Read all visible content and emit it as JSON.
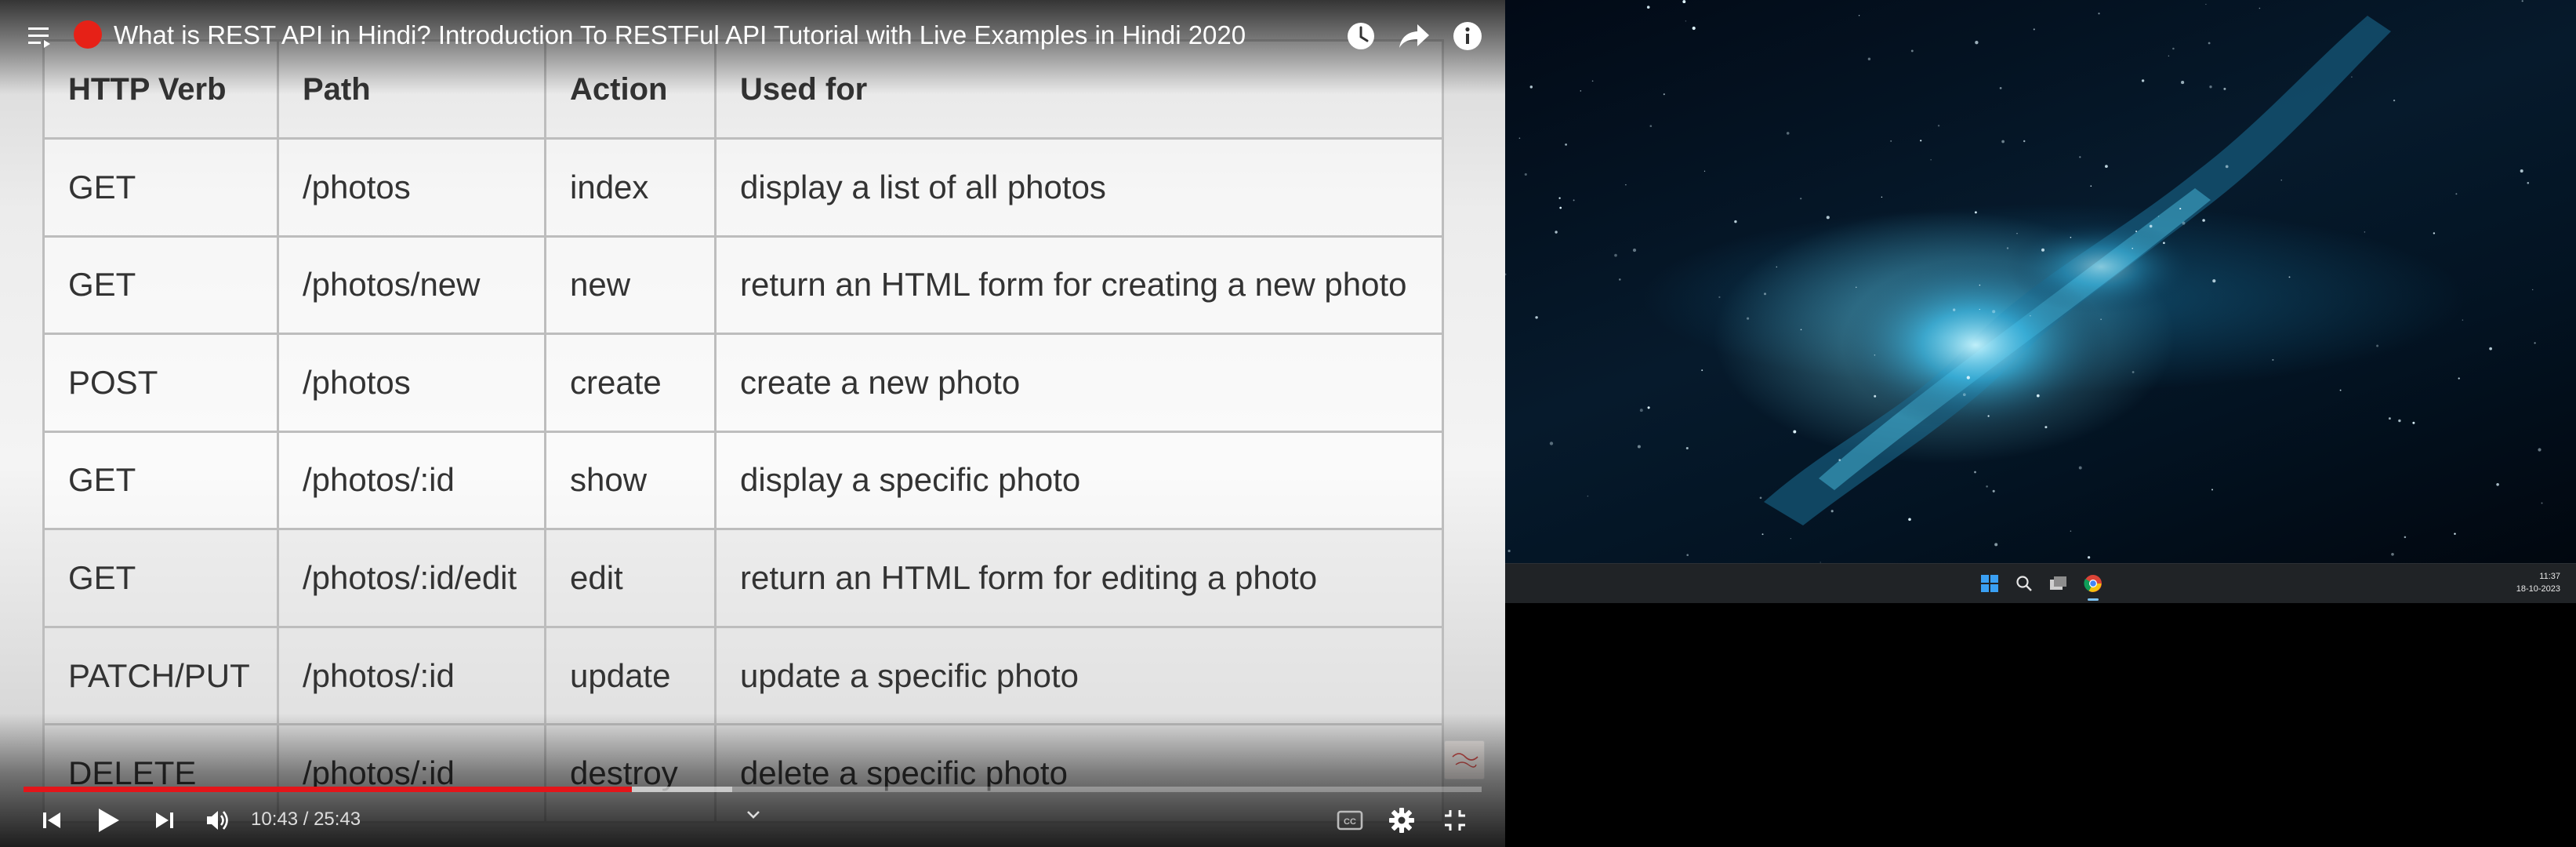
{
  "video": {
    "title": "What is REST API in Hindi? Introduction To RESTFul API Tutorial with Live Examples in Hindi 2020",
    "current_time": "10:43",
    "duration": "25:43",
    "time_display": "10:43 / 25:43",
    "progress_fraction": 0.417,
    "buffered_fraction": 0.486
  },
  "table": {
    "headers": [
      "HTTP Verb",
      "Path",
      "Action",
      "Used for"
    ],
    "rows": [
      [
        "GET",
        "/photos",
        "index",
        "display a list of all photos"
      ],
      [
        "GET",
        "/photos/new",
        "new",
        "return an HTML form for creating a new photo"
      ],
      [
        "POST",
        "/photos",
        "create",
        "create a new photo"
      ],
      [
        "GET",
        "/photos/:id",
        "show",
        "display a specific photo"
      ],
      [
        "GET",
        "/photos/:id/edit",
        "edit",
        "return an HTML form for editing a photo"
      ],
      [
        "PATCH/PUT",
        "/photos/:id",
        "update",
        "update a specific photo"
      ],
      [
        "DELETE",
        "/photos/:id",
        "destroy",
        "delete a specific photo"
      ]
    ]
  },
  "taskbar": {
    "time": "11:37",
    "date": "18-10-2023"
  },
  "icons": {
    "playlist": "playlist-icon",
    "watch_later": "clock-icon",
    "share": "share-icon",
    "info": "info-icon",
    "prev": "skip-previous-icon",
    "play": "play-icon",
    "next": "skip-next-icon",
    "volume": "volume-icon",
    "chevron": "chevron-down-icon",
    "captions": "captions-icon",
    "settings": "gear-icon",
    "exit_fullscreen": "exit-fullscreen-icon"
  },
  "colors": {
    "progress": "#e3151a",
    "record_dot": "#e62117",
    "taskbar": "#202326"
  }
}
